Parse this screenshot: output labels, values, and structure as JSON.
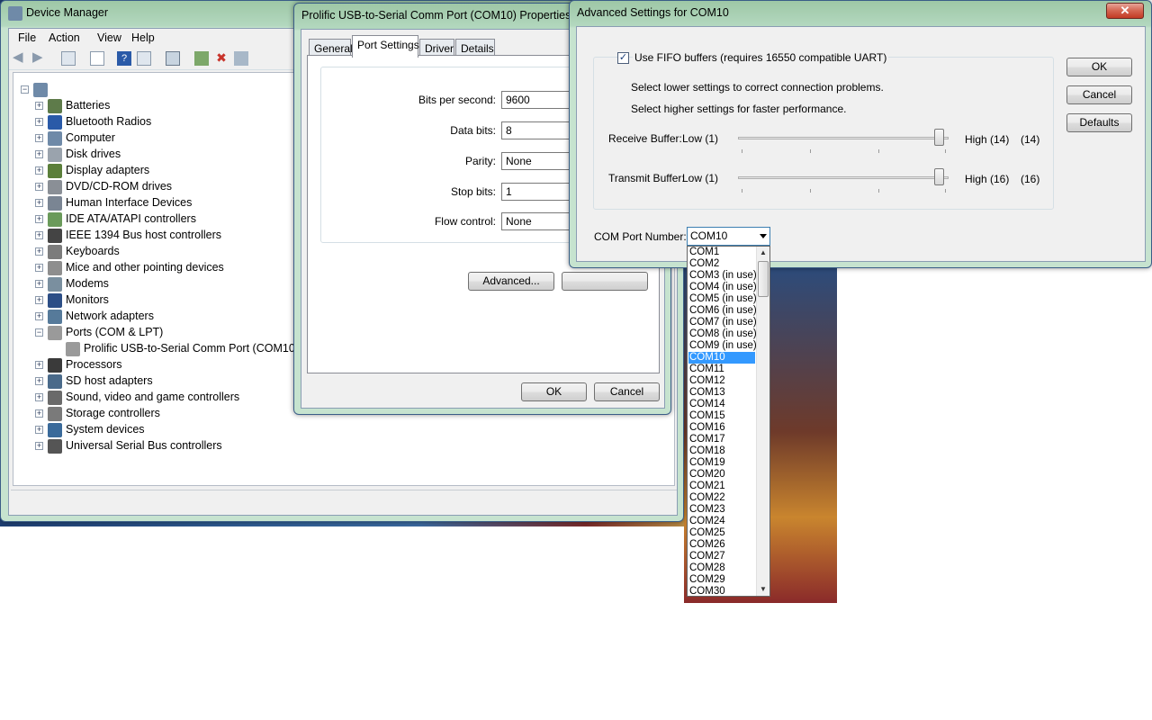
{
  "device_manager": {
    "title": "Device Manager",
    "menu": [
      "File",
      "Action",
      "View",
      "Help"
    ],
    "tree": [
      {
        "label": "Batteries",
        "expanded": false,
        "icon": "battery-icon"
      },
      {
        "label": "Bluetooth Radios",
        "expanded": false,
        "icon": "bluetooth-icon"
      },
      {
        "label": "Computer",
        "expanded": false,
        "icon": "computer-icon"
      },
      {
        "label": "Disk drives",
        "expanded": false,
        "icon": "disk-drive-icon"
      },
      {
        "label": "Display adapters",
        "expanded": false,
        "icon": "display-adapter-icon"
      },
      {
        "label": "DVD/CD-ROM drives",
        "expanded": false,
        "icon": "dvd-drive-icon"
      },
      {
        "label": "Human Interface Devices",
        "expanded": false,
        "icon": "hid-icon"
      },
      {
        "label": "IDE ATA/ATAPI controllers",
        "expanded": false,
        "icon": "ide-controller-icon"
      },
      {
        "label": "IEEE 1394 Bus host controllers",
        "expanded": false,
        "icon": "ieee1394-icon"
      },
      {
        "label": "Keyboards",
        "expanded": false,
        "icon": "keyboard-icon"
      },
      {
        "label": "Mice and other pointing devices",
        "expanded": false,
        "icon": "mouse-icon"
      },
      {
        "label": "Modems",
        "expanded": false,
        "icon": "modem-icon"
      },
      {
        "label": "Monitors",
        "expanded": false,
        "icon": "monitor-icon"
      },
      {
        "label": "Network adapters",
        "expanded": false,
        "icon": "network-adapter-icon"
      },
      {
        "label": "Ports (COM & LPT)",
        "expanded": true,
        "icon": "port-icon"
      },
      {
        "label": "Prolific USB-to-Serial Comm Port (COM10)",
        "child": true,
        "icon": "serial-port-icon"
      },
      {
        "label": "Processors",
        "expanded": false,
        "icon": "processor-icon"
      },
      {
        "label": "SD host adapters",
        "expanded": false,
        "icon": "sd-adapter-icon"
      },
      {
        "label": "Sound, video and game controllers",
        "expanded": false,
        "icon": "speaker-icon"
      },
      {
        "label": "Storage controllers",
        "expanded": false,
        "icon": "storage-controller-icon"
      },
      {
        "label": "System devices",
        "expanded": false,
        "icon": "system-device-icon"
      },
      {
        "label": "Universal Serial Bus controllers",
        "expanded": false,
        "icon": "usb-icon"
      }
    ]
  },
  "properties": {
    "title": "Prolific USB-to-Serial Comm Port (COM10) Properties",
    "tabs": [
      "General",
      "Port Settings",
      "Driver",
      "Details"
    ],
    "active_tab": "Port Settings",
    "fields": [
      {
        "label": "Bits per second:",
        "value": "9600"
      },
      {
        "label": "Data bits:",
        "value": "8"
      },
      {
        "label": "Parity:",
        "value": "None"
      },
      {
        "label": "Stop bits:",
        "value": "1"
      },
      {
        "label": "Flow control:",
        "value": "None"
      }
    ],
    "advanced_button": "Advanced...",
    "ok": "OK",
    "cancel": "Cancel"
  },
  "advanced": {
    "title": "Advanced Settings for COM10",
    "fifo_label": "Use FIFO buffers (requires 16550 compatible UART)",
    "fifo_checked": true,
    "hint_lower": "Select lower settings to correct connection problems.",
    "hint_higher": "Select higher settings for faster performance.",
    "receive": {
      "label": "Receive Buffer:",
      "low": "Low (1)",
      "high": "High (14)",
      "value": "(14)",
      "level": 1.0
    },
    "transmit": {
      "label": "Transmit Buffer:",
      "low": "Low (1)",
      "high": "High (16)",
      "value": "(16)",
      "level": 1.0
    },
    "com_port_label": "COM Port Number:",
    "com_port_value": "COM10",
    "ok": "OK",
    "cancel": "Cancel",
    "defaults": "Defaults",
    "close_glyph": "✕",
    "com_options": [
      "COM1",
      "COM2",
      "COM3 (in use)",
      "COM4 (in use)",
      "COM5 (in use)",
      "COM6 (in use)",
      "COM7 (in use)",
      "COM8 (in use)",
      "COM9 (in use)",
      "COM10",
      "COM11",
      "COM12",
      "COM13",
      "COM14",
      "COM15",
      "COM16",
      "COM17",
      "COM18",
      "COM19",
      "COM20",
      "COM21",
      "COM22",
      "COM23",
      "COM24",
      "COM25",
      "COM26",
      "COM27",
      "COM28",
      "COM29",
      "COM30"
    ],
    "selected_option": "COM10"
  },
  "colors": {
    "selection": "#3399ff",
    "title_bar": "#b3d8bf"
  }
}
